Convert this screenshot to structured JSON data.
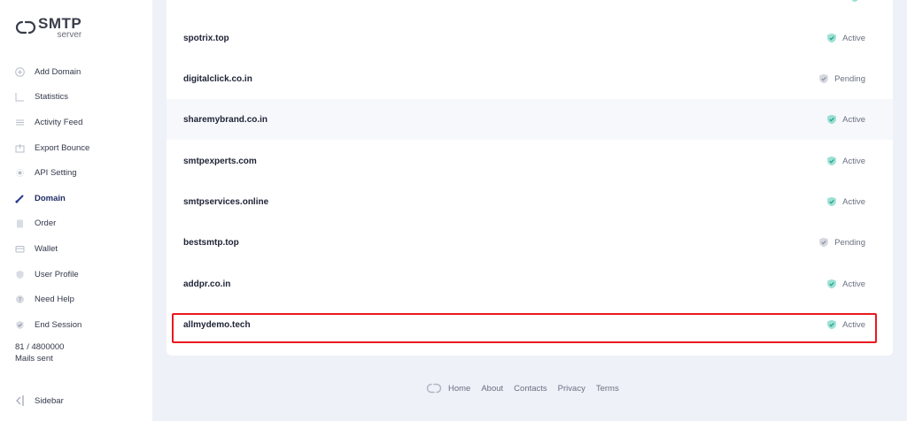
{
  "brand": {
    "name": "SMTP",
    "sub": "server"
  },
  "nav": [
    {
      "label": "Add Domain",
      "icon": "plus-circle-icon"
    },
    {
      "label": "Statistics",
      "icon": "chart-icon"
    },
    {
      "label": "Activity Feed",
      "icon": "list-icon"
    },
    {
      "label": "Export Bounce",
      "icon": "export-icon"
    },
    {
      "label": "API Setting",
      "icon": "gear-icon"
    },
    {
      "label": "Domain",
      "icon": "tag-icon",
      "active": true
    },
    {
      "label": "Order",
      "icon": "clipboard-icon"
    },
    {
      "label": "Wallet",
      "icon": "wallet-icon"
    },
    {
      "label": "User Profile",
      "icon": "shield-icon"
    },
    {
      "label": "Need Help",
      "icon": "help-icon"
    },
    {
      "label": "End Session",
      "icon": "shield-check-icon"
    }
  ],
  "mails": {
    "count": "81 / 4800000",
    "label": "Mails sent"
  },
  "sidebar_toggle": {
    "label": "Sidebar"
  },
  "domains": [
    {
      "name": "spotrix.top",
      "status": "Active"
    },
    {
      "name": "digitalclick.co.in",
      "status": "Pending"
    },
    {
      "name": "sharemybrand.co.in",
      "status": "Active"
    },
    {
      "name": "smtpexperts.com",
      "status": "Active"
    },
    {
      "name": "smtpservices.online",
      "status": "Active"
    },
    {
      "name": "bestsmtp.top",
      "status": "Pending"
    },
    {
      "name": "addpr.co.in",
      "status": "Active"
    },
    {
      "name": "allmydemo.tech",
      "status": "Active"
    }
  ],
  "colors": {
    "active": "#4cc9b0",
    "pending": "#c4c8d2",
    "highlight": "#e8191f"
  },
  "footer": {
    "links": [
      "Home",
      "About",
      "Contacts",
      "Privacy",
      "Terms"
    ]
  }
}
